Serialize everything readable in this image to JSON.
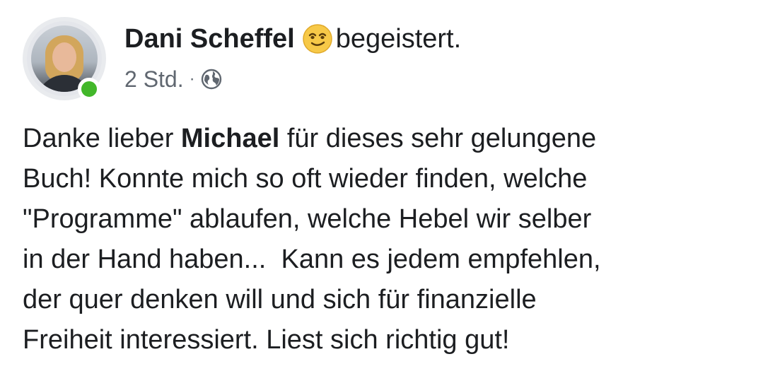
{
  "post": {
    "author": "Dani Scheffel",
    "feeling": "begeistert.",
    "feeling_icon": "smiling-face-icon",
    "time": "2 Std.",
    "separator": "·",
    "audience_icon": "globe-icon",
    "online_status_color": "#42b72a",
    "message_lines": [
      [
        "Danke lieber ",
        "Michael",
        " für dieses sehr gelungene"
      ],
      "Buch! Konnte mich so oft wieder finden, welche",
      "\"Programme\" ablaufen, welche Hebel wir selber",
      "in der Hand haben...  Kann es jedem empfehlen,",
      "der quer denken will und sich für finanzielle",
      "Freiheit interessiert. Liest sich richtig gut!"
    ]
  }
}
